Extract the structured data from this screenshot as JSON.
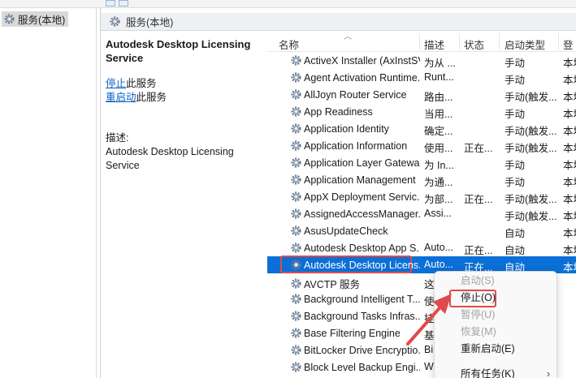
{
  "tree": {
    "root_label": "服务(本地)"
  },
  "pane": {
    "header_label": "服务(本地)"
  },
  "details": {
    "service_title": "Autodesk Desktop Licensing Service",
    "stop_link": "停止",
    "stop_suffix": "此服务",
    "restart_link": "重启动",
    "restart_suffix": "此服务",
    "desc_label": "描述:",
    "desc_text": "Autodesk Desktop Licensing Service"
  },
  "columns": {
    "name": "名称",
    "description": "描述",
    "status": "状态",
    "startup": "启动类型",
    "logon": "登"
  },
  "services": [
    {
      "name": "ActiveX Installer (AxInstSV)",
      "desc": "为从 ...",
      "status": "",
      "startup": "手动",
      "logon": "本地"
    },
    {
      "name": "Agent Activation Runtime...",
      "desc": "Runt...",
      "status": "",
      "startup": "手动",
      "logon": "本地"
    },
    {
      "name": "AllJoyn Router Service",
      "desc": "路由...",
      "status": "",
      "startup": "手动(触发...",
      "logon": "本地"
    },
    {
      "name": "App Readiness",
      "desc": "当用...",
      "status": "",
      "startup": "手动",
      "logon": "本地"
    },
    {
      "name": "Application Identity",
      "desc": "确定...",
      "status": "",
      "startup": "手动(触发...",
      "logon": "本地"
    },
    {
      "name": "Application Information",
      "desc": "使用...",
      "status": "正在...",
      "startup": "手动(触发...",
      "logon": "本地"
    },
    {
      "name": "Application Layer Gatewa...",
      "desc": "为 In...",
      "status": "",
      "startup": "手动",
      "logon": "本地"
    },
    {
      "name": "Application Management",
      "desc": "为通...",
      "status": "",
      "startup": "手动",
      "logon": "本地"
    },
    {
      "name": "AppX Deployment Servic...",
      "desc": "为部...",
      "status": "正在...",
      "startup": "手动(触发...",
      "logon": "本地"
    },
    {
      "name": "AssignedAccessManager...",
      "desc": "Assi...",
      "status": "",
      "startup": "手动(触发...",
      "logon": "本地"
    },
    {
      "name": "AsusUpdateCheck",
      "desc": "",
      "status": "",
      "startup": "自动",
      "logon": "本地"
    },
    {
      "name": "Autodesk Desktop App S...",
      "desc": "Auto...",
      "status": "正在...",
      "startup": "自动",
      "logon": "本地"
    },
    {
      "name": "Autodesk Desktop Licens...",
      "desc": "Auto...",
      "status": "正在...",
      "startup": "自动",
      "logon": "本地"
    },
    {
      "name": "AVCTP 服务",
      "desc": "这",
      "status": "",
      "startup": "",
      "logon": ""
    },
    {
      "name": "Background Intelligent T...",
      "desc": "使",
      "status": "",
      "startup": "",
      "logon": ""
    },
    {
      "name": "Background Tasks Infras...",
      "desc": "挂",
      "status": "",
      "startup": "",
      "logon": ""
    },
    {
      "name": "Base Filtering Engine",
      "desc": "基",
      "status": "",
      "startup": "",
      "logon": ""
    },
    {
      "name": "BitLocker Drive Encryptio...",
      "desc": "Bi",
      "status": "",
      "startup": "",
      "logon": ""
    },
    {
      "name": "Block Level Backup Engi...",
      "desc": "W",
      "status": "",
      "startup": "",
      "logon": ""
    }
  ],
  "context_menu": {
    "items": [
      {
        "label": "启动(S)",
        "enabled": false
      },
      {
        "label": "停止(O)",
        "enabled": true
      },
      {
        "label": "暂停(U)",
        "enabled": false
      },
      {
        "label": "恢复(M)",
        "enabled": false
      },
      {
        "label": "重新启动(E)",
        "enabled": true
      },
      {
        "label": "所有任务(K)",
        "enabled": true,
        "arrow": "›"
      }
    ]
  },
  "colors": {
    "selection": "#0a6fd6",
    "highlight_box": "#e04a4a",
    "link": "#0a5fc7"
  }
}
